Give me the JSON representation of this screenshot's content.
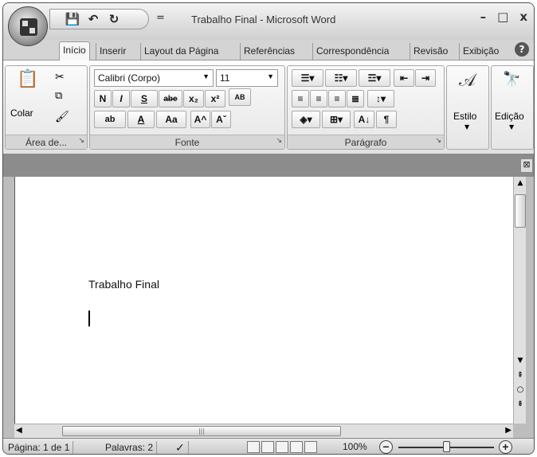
{
  "window": {
    "title": "Trabalho Final - Microsoft Word",
    "minimize": "–",
    "maximize": "□",
    "close": "x"
  },
  "qat": {
    "save": "💾",
    "undo": "↶",
    "redo": "↻",
    "more": "="
  },
  "tabs": [
    "Início",
    "Inserir",
    "Layout da Página",
    "Referências",
    "Correspondência",
    "Revisão",
    "Exibição"
  ],
  "ribbon": {
    "clipboard": {
      "label": "Área de...",
      "paste_label": "Colar"
    },
    "font": {
      "label": "Fonte",
      "font_name": "Calibri (Corpo)",
      "font_size": "11",
      "bold": "N",
      "italic": "I",
      "underline": "S",
      "strike": "abe",
      "subscript": "x₂",
      "superscript": "x²",
      "clear": "AB",
      "highlight": "ab",
      "font_color": "A",
      "change_case": "Aa",
      "grow": "A^",
      "shrink": "Aˇ"
    },
    "paragraph": {
      "label": "Parágrafo",
      "pilcrow": "¶"
    },
    "styles": {
      "label": "Estilo"
    },
    "editing": {
      "label": "Edição"
    }
  },
  "document": {
    "text": "Trabalho Final"
  },
  "status": {
    "page": "Página: 1 de 1",
    "words": "Palavras: 2",
    "zoom": "100%"
  },
  "icons": [
    "office-button-icon",
    "save-icon",
    "undo-icon",
    "redo-icon",
    "help-icon",
    "paste-icon",
    "cut-icon",
    "copy-icon",
    "format-painter-icon",
    "style-icon",
    "find-icon",
    "spelling-icon"
  ]
}
